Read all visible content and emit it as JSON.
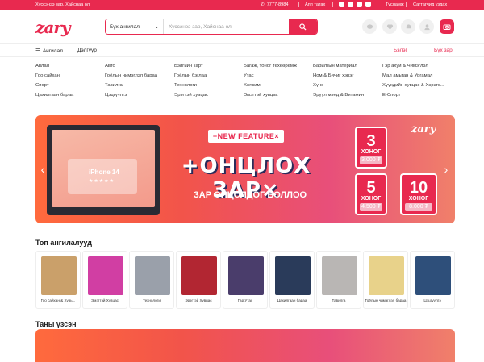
{
  "topbar": {
    "tagline": "Хуссэнээ зар, Хайснаа ол",
    "phone": "7777-8984",
    "app_download": "Апп татах",
    "help": "Тусламж",
    "merchant": "Сагтагчид уздах",
    "socials": [
      "facebook-icon",
      "instagram-icon",
      "twitter-icon",
      "linkedin-icon"
    ]
  },
  "header": {
    "logo": "zary",
    "search": {
      "category": "Бүх ангилал",
      "placeholder": "Хуссэнээ зар, Хайснаа ол"
    },
    "icons": [
      "chat-icon",
      "heart-icon",
      "bell-icon",
      "user-icon",
      "camera-icon"
    ]
  },
  "nav": {
    "home": "Ангилал",
    "shop": "Дэлгүүр",
    "login": "Бэлэг",
    "post": "Бүх зар"
  },
  "categories": [
    "Авлал",
    "Авто",
    "Бэлгийн карт",
    "Багаж, тоног төхөөрөмж",
    "Барилгын материал",
    "Гэр ахуй & Чимэглэл",
    "Гоо сайхан",
    "Гоёлын чимэглэл бараа",
    "Гоёлын бэглаа",
    "Утас",
    "Ном & Бичиг хэрэг",
    "Мал амьтан & Ургамал",
    "Спорт",
    "Тавилга",
    "Технологи",
    "Хөгжим",
    "Хүнс",
    "Хүүхдийн хувцас & Хэрэгс...",
    "Цахилгаан бараа",
    "Цэцгүүлгэ",
    "Эрэгтэй хувцас",
    "Эмэгтэй хувцас",
    "Эрүүл мэнд & Витамин",
    "E-Спорт"
  ],
  "banner": {
    "feature": "+NEW FEATURE×",
    "headline": "+ОНЦЛОХ ЗАР×",
    "subline": "ЗАР ОНЦОЛДОГ БОЛЛОО",
    "phone_label": "iPhone 14",
    "stars": "★★★★★",
    "brand": "zary",
    "tiles": [
      {
        "days": "3",
        "unit": "ХОНОГ",
        "price": "3.000 ₮"
      },
      {
        "days": "5",
        "unit": "ХОНОГ",
        "price": "4.500 ₮"
      },
      {
        "days": "10",
        "unit": "ХОНОГ",
        "price": "8.000 ₮"
      }
    ]
  },
  "top_categories": {
    "title": "Топ ангилалууд",
    "items": [
      {
        "label": "Гоо сайхан & Хувь...",
        "color": "#caa06a"
      },
      {
        "label": "Эмэгтэй Хувцас",
        "color": "#d13ea3"
      },
      {
        "label": "Технологи",
        "color": "#9aa0aa"
      },
      {
        "label": "Эрэгтэй Хувцас",
        "color": "#b22632"
      },
      {
        "label": "Гар Утас",
        "color": "#4a3d6b"
      },
      {
        "label": "Цахилгаан бараа",
        "color": "#2a3b5a"
      },
      {
        "label": "Тавилга",
        "color": "#b9b6b4"
      },
      {
        "label": "Гоёлын чимэглэл бараа",
        "color": "#e8d28a"
      },
      {
        "label": "Цэцгүүлгэ",
        "color": "#2e4f7a"
      }
    ]
  },
  "recent": {
    "title": "Таны үзсэн"
  }
}
